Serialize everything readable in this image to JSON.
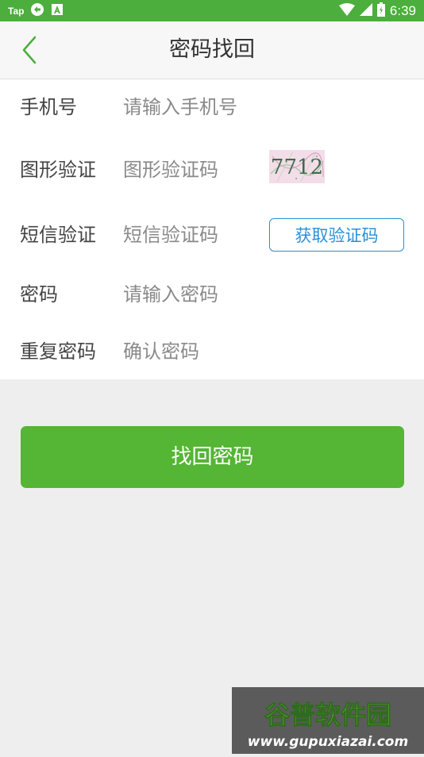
{
  "status_bar": {
    "left_label": "Tap",
    "icons": [
      "swap-icon",
      "a-badge-icon",
      "wifi-icon",
      "signal-icon",
      "battery-icon"
    ],
    "time": "6:39"
  },
  "header": {
    "back_icon": "chevron-left-icon",
    "title": "密码找回"
  },
  "form": {
    "phone": {
      "label": "手机号",
      "placeholder": "请输入手机号"
    },
    "captcha": {
      "label": "图形验证",
      "placeholder": "图形验证码",
      "image_text": "7712"
    },
    "sms": {
      "label": "短信验证",
      "placeholder": "短信验证码",
      "button_label": "获取验证码"
    },
    "password": {
      "label": "密码",
      "placeholder": "请输入密码"
    },
    "confirm": {
      "label": "重复密码",
      "placeholder": "确认密码"
    }
  },
  "submit_label": "找回密码",
  "watermark": {
    "title": "谷普软件园",
    "url": "www.gupuxiazai.com"
  },
  "colors": {
    "status_bar": "#4cae3c",
    "accent_green": "#55b535",
    "link_blue": "#2a8fd6",
    "background": "#eeeeee"
  }
}
